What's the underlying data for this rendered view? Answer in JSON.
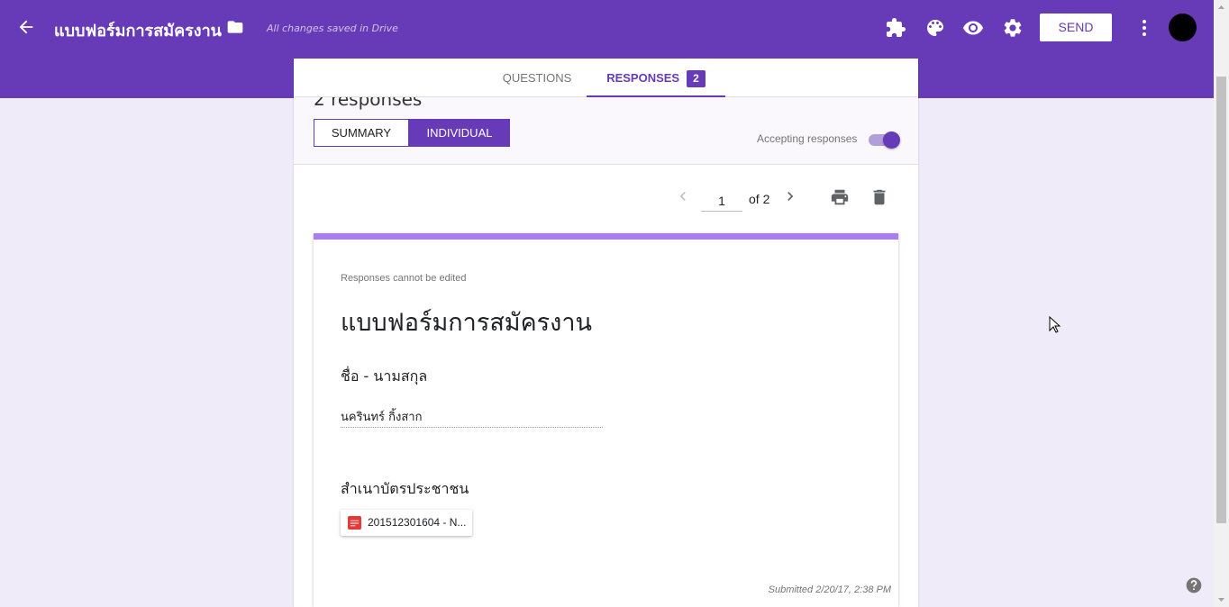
{
  "header": {
    "form_title": "แบบฟอร์มการสมัครงาน",
    "saved_status": "All changes saved in Drive",
    "send_label": "SEND",
    "icons": [
      "back-arrow-icon",
      "folder-icon",
      "addon-puzzle-icon",
      "palette-icon",
      "preview-eye-icon",
      "settings-gear-icon",
      "more-vert-icon"
    ]
  },
  "tabs": [
    {
      "label": "QUESTIONS",
      "active": false
    },
    {
      "label": "RESPONSES",
      "active": true,
      "badge": "2"
    }
  ],
  "responses": {
    "count_text": "2 responses",
    "view_summary_label": "SUMMARY",
    "view_individual_label": "INDIVIDUAL",
    "active_view": "INDIVIDUAL",
    "accepting_label": "Accepting responses",
    "accepting": true
  },
  "pager": {
    "current": "1",
    "of_text": "of 2"
  },
  "response": {
    "notice": "Responses cannot be edited",
    "title": "แบบฟอร์มการสมัครงาน",
    "questions": [
      {
        "label": "ชื่อ - นามสกุล",
        "answer": "นครินทร์ กิ้งสาก"
      },
      {
        "label": "สำเนาบัตรประชาชน",
        "file": "201512301604 - N..."
      }
    ],
    "submitted": "Submitted 2/20/17, 2:38 PM"
  },
  "colors": {
    "brand": "#673ab7",
    "brand_light": "#a77ff2",
    "background": "#f0ebf8"
  }
}
